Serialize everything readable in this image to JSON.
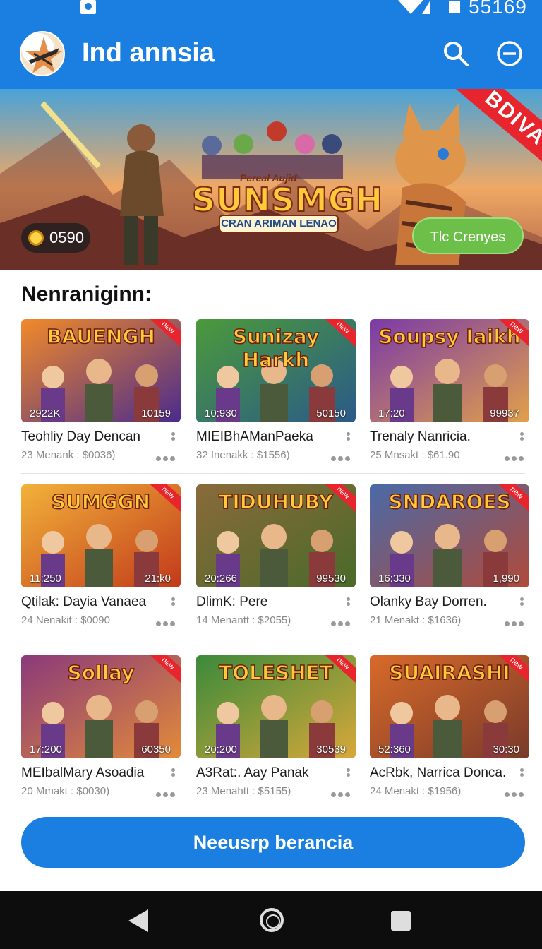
{
  "status_bar": {
    "time": "55169"
  },
  "app_bar": {
    "title": "Ind annsia",
    "logo_icon": "game-logo-icon",
    "search_icon": "search-icon",
    "menu_icon": "minus-circle-icon"
  },
  "banner": {
    "top_text": "Pereal Aujid",
    "title": "SUNSMGH",
    "subtitle": "CRAN ARIMAN LENAO",
    "coin_value": "0590",
    "cta_label": "Tlc Crenyes",
    "ribbon": "BDIVA"
  },
  "section": {
    "title": "Nenraniginn:"
  },
  "cards": [
    {
      "thumb_title": "BAUENGH",
      "left_stat": "2922K",
      "right_stat": "10159",
      "title": "Teohliy Day Dencan",
      "meta": "23 Menank : $0036)",
      "tag": "new",
      "bg1": "#f28a2a",
      "bg2": "#4b2b8c"
    },
    {
      "thumb_title": "Sunizay Harkh",
      "left_stat": "10:930",
      "right_stat": "50150",
      "title": "MIEIBhAManPaeka",
      "meta": "32 Inenakk : $1556)",
      "tag": "new",
      "bg1": "#4b9a3a",
      "bg2": "#2a5a8a"
    },
    {
      "thumb_title": "Soupsy Iaikh",
      "left_stat": "17:20",
      "right_stat": "99937",
      "title": "Trenaly Nanricia.",
      "meta": "25 Mnsakt : $61.90",
      "tag": "new",
      "bg1": "#7a3aa8",
      "bg2": "#e2a04a"
    },
    {
      "thumb_title": "SUMGGN",
      "left_stat": "11:250",
      "right_stat": "21:k0",
      "title": "Qtilak: Dayia Vanaea",
      "meta": "24 Nenakit : $0090",
      "tag": "new",
      "bg1": "#f2b23a",
      "bg2": "#c23a1a"
    },
    {
      "thumb_title": "TIDUHUBY",
      "left_stat": "20:266",
      "right_stat": "99530",
      "title": "DlimK: Pere",
      "meta": "14 Menantt : $2055)",
      "tag": "new",
      "bg1": "#8a6a3a",
      "bg2": "#4a6a2a"
    },
    {
      "thumb_title": "SNDAROES",
      "left_stat": "16:330",
      "right_stat": "1,990",
      "title": "Olanky Bay Dorren.",
      "meta": "21 Menakt : $1636)",
      "tag": "new",
      "bg1": "#4a6aa8",
      "bg2": "#b04a3a"
    },
    {
      "thumb_title": "Sollay",
      "left_stat": "17:200",
      "right_stat": "60350",
      "title": "MEIbalMary Asoadia",
      "meta": "20 Mmakt : $0030)",
      "tag": "new",
      "bg1": "#8a3a7a",
      "bg2": "#e28a3a"
    },
    {
      "thumb_title": "TOLESHET",
      "left_stat": "20:200",
      "right_stat": "30539",
      "title": "A3Rat:. Aay Panak",
      "meta": "23 Menahtt : $5155)",
      "tag": "new",
      "bg1": "#3a8a3a",
      "bg2": "#d8a83a"
    },
    {
      "thumb_title": "SUAIRASHI",
      "left_stat": "52:360",
      "right_stat": "30:30",
      "title": "AcRbk, Narrica Donca.",
      "meta": "24 Menakt : $1956)",
      "tag": "new",
      "bg1": "#d86a2a",
      "bg2": "#7a3a2a"
    }
  ],
  "primary_button": {
    "label": "Neeusrp berancia"
  },
  "nav_bar": {
    "back_icon": "back-triangle-icon",
    "home_icon": "home-circle-icon",
    "recents_icon": "recents-square-icon"
  },
  "colors": {
    "primary": "#1a7fe0",
    "accent_green": "#6cc04a",
    "ribbon_red": "#e8252c"
  }
}
